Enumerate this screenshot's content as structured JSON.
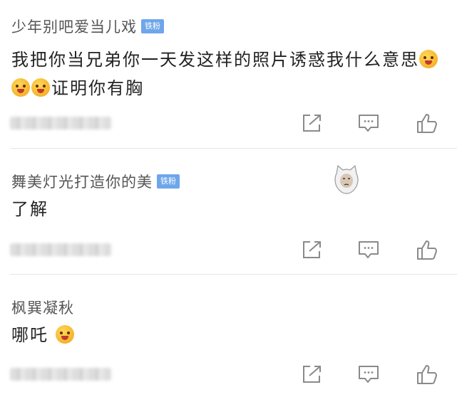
{
  "comments": [
    {
      "username": "少年别吧爱当儿戏",
      "badge": "铁粉",
      "text_part1": "我把你当兄弟你一天发这样的照片诱惑我什么意思",
      "text_part2": "证明你有胸",
      "emoji_count": 3,
      "emoji_icon": "tongue-out-emoji-icon"
    },
    {
      "username": "舞美灯光打造你的美",
      "badge": "铁粉",
      "text": "了解",
      "sticker_icon": "cat-face-sticker-icon"
    },
    {
      "username": "枫巽凝秋",
      "text": "哪吒",
      "emoji_icon": "smile-emoji-icon"
    }
  ],
  "actions": {
    "share_icon": "share-icon",
    "reply_icon": "comment-icon",
    "like_icon": "thumbs-up-icon"
  },
  "colors": {
    "badge": "#6ea6ea",
    "icon": "#8a8a8a",
    "divider": "#e6e6e6"
  }
}
